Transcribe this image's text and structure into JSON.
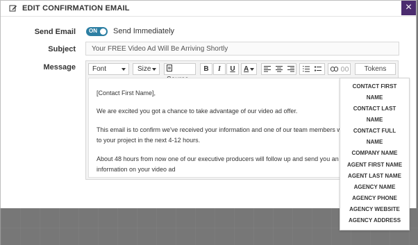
{
  "header": {
    "title": "EDIT CONFIRMATION EMAIL",
    "close_label": "×"
  },
  "form": {
    "send_email_label": "Send Email",
    "toggle_on_text": "ON",
    "toggle_caption": "Send Immediately",
    "subject_label": "Subject",
    "subject_value": "Your FREE Video Ad Will Be Arriving Shortly",
    "message_label": "Message"
  },
  "toolbar": {
    "font_label": "Font",
    "size_label": "Size",
    "source_label": "Source",
    "bold_label": "B",
    "italic_label": "I",
    "underline_label": "U",
    "text_color_label": "A",
    "tokens_label": "Tokens"
  },
  "message_body": [
    "[Contact First Name],",
    "We are excited you got a chance to take advantage of our video ad offer.",
    "This email is to confirm we've received your information and one of our team members will",
    "to your project in the next 4-12 hours.",
    "About 48 hours from now one of our executive producers will follow up and send you an en",
    "information on your video ad"
  ],
  "tokens": [
    "CONTACT FIRST",
    "NAME",
    "CONTACT LAST",
    "NAME",
    "CONTACT FULL",
    "NAME",
    "COMPANY NAME",
    "AGENT FIRST NAME",
    "AGENT LAST NAME",
    "AGENCY NAME",
    "AGENCY PHONE",
    "AGENCY WEBSITE",
    "AGENCY ADDRESS"
  ],
  "colors": {
    "accent": "#4b2c6f",
    "toggle": "#2d7fa3"
  },
  "icons": {
    "edit": "edit-icon",
    "close": "close-icon",
    "source": "source-icon",
    "align_left": "align-left-icon",
    "align_center": "align-center-icon",
    "align_right": "align-right-icon",
    "ordered_list": "ordered-list-icon",
    "unordered_list": "unordered-list-icon",
    "link": "link-icon",
    "unlink": "unlink-icon"
  }
}
